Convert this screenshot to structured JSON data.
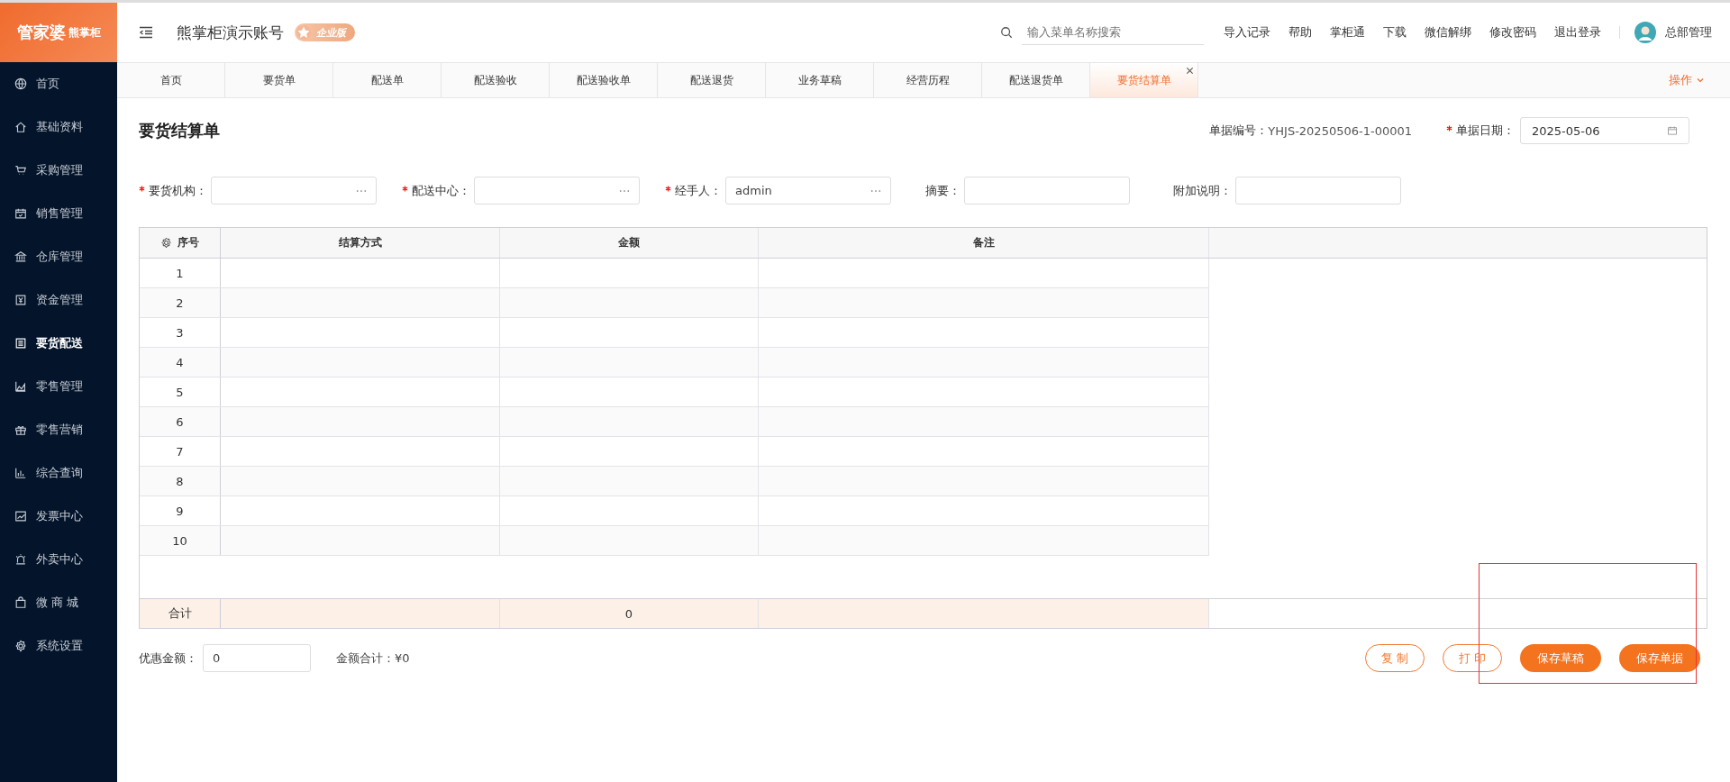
{
  "sidebar": {
    "logo": {
      "brand": "管家婆",
      "sub": "熊掌柜"
    },
    "items": [
      {
        "label": "首页",
        "kind": "globe",
        "selected": false
      },
      {
        "label": "基础资料",
        "kind": "home",
        "selected": false
      },
      {
        "label": "采购管理",
        "kind": "cart",
        "selected": false
      },
      {
        "label": "销售管理",
        "kind": "calendar",
        "selected": false
      },
      {
        "label": "仓库管理",
        "kind": "bank",
        "selected": false
      },
      {
        "label": "资金管理",
        "kind": "money",
        "selected": false
      },
      {
        "label": "要货配送",
        "kind": "list",
        "selected": true
      },
      {
        "label": "零售管理",
        "kind": "area",
        "selected": false
      },
      {
        "label": "零售营销",
        "kind": "gift",
        "selected": false
      },
      {
        "label": "综合查询",
        "kind": "bars",
        "selected": false
      },
      {
        "label": "发票中心",
        "kind": "trend",
        "selected": false
      },
      {
        "label": "外卖中心",
        "kind": "alarm",
        "selected": false
      },
      {
        "label": "微 商 城",
        "kind": "bag",
        "selected": false
      },
      {
        "label": "系统设置",
        "kind": "gear",
        "selected": false
      }
    ]
  },
  "header": {
    "title": "熊掌柜演示账号",
    "edition": "企业版",
    "search": {
      "placeholder": "输入菜单名称搜索"
    },
    "links": [
      "导入记录",
      "帮助",
      "掌柜通",
      "下载",
      "微信解绑",
      "修改密码",
      "退出登录"
    ],
    "user": "总部管理"
  },
  "tabs": [
    {
      "label": "首页",
      "selected": false
    },
    {
      "label": "要货单",
      "selected": false
    },
    {
      "label": "配送单",
      "selected": false
    },
    {
      "label": "配送验收",
      "selected": false
    },
    {
      "label": "配送验收单",
      "selected": false
    },
    {
      "label": "配送退货",
      "selected": false
    },
    {
      "label": "业务草稿",
      "selected": false
    },
    {
      "label": "经营历程",
      "selected": false
    },
    {
      "label": "配送退货单",
      "selected": false
    },
    {
      "label": "要货结算单",
      "selected": true
    }
  ],
  "tab_actions": "操作",
  "page_title": "要货结算单",
  "doc_number": {
    "label": "单据编号：",
    "value": "YHJS-20250506-1-00001"
  },
  "doc_date": {
    "label": "单据日期：",
    "value": "2025-05-06",
    "required": true
  },
  "fields": [
    {
      "label": "要货机构：",
      "required": true,
      "kind": "picker"
    },
    {
      "label": "配送中心：",
      "required": true,
      "kind": "picker"
    },
    {
      "label": "经手人：",
      "required": true,
      "kind": "picker",
      "value": "admin"
    },
    {
      "label": "摘要：",
      "required": false,
      "kind": "text"
    },
    {
      "label": "附加说明：",
      "required": false,
      "kind": "text"
    }
  ],
  "table": {
    "columns": [
      "序号",
      "结算方式",
      "金额",
      "备注"
    ],
    "rows": [
      "1",
      "2",
      "3",
      "4",
      "5",
      "6",
      "7",
      "8",
      "9",
      "10"
    ],
    "total": {
      "label": "合计",
      "cells": [
        "",
        "0",
        ""
      ]
    }
  },
  "discount": {
    "label": "优惠金额：",
    "value": "0"
  },
  "amount_total": "金额合计：¥0",
  "buttons": [
    {
      "label": "复 制",
      "kind": "outline"
    },
    {
      "label": "打 印",
      "kind": "outline"
    },
    {
      "label": "保存草稿",
      "kind": "primary"
    },
    {
      "label": "保存单据",
      "kind": "primary"
    }
  ]
}
